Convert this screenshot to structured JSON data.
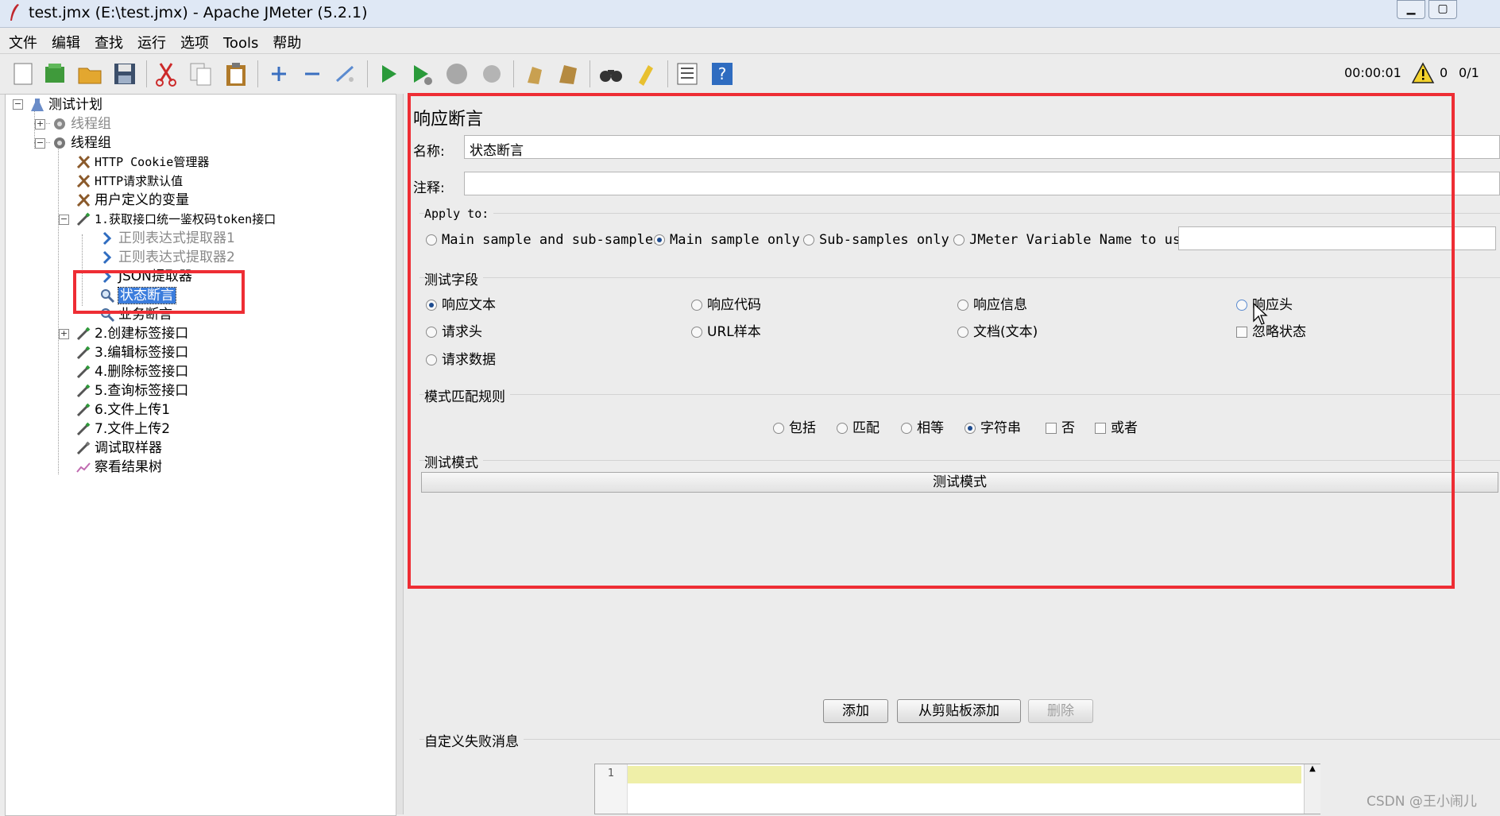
{
  "window": {
    "title": "test.jmx (E:\\test.jmx) - Apache JMeter (5.2.1)"
  },
  "menu": [
    "文件",
    "编辑",
    "查找",
    "运行",
    "选项",
    "Tools",
    "帮助"
  ],
  "status": {
    "elapsed": "00:00:01",
    "warnings": "0",
    "threads": "0/1"
  },
  "tree": {
    "root": "测试计划",
    "group1": "线程组",
    "group2": "线程组",
    "items": {
      "cookie": "HTTP Cookie管理器",
      "defaults": "HTTP请求默认值",
      "vars": "用户定义的变量",
      "req1": "1.获取接口统一鉴权码token接口",
      "regex1": "正则表达式提取器1",
      "regex2": "正则表达式提取器2",
      "json": "JSON提取器",
      "status_assert": "状态断言",
      "biz_assert": "业务断言",
      "req2": "2.创建标签接口",
      "req3": "3.编辑标签接口",
      "req4": "4.删除标签接口",
      "req5": "5.查询标签接口",
      "req6": "6.文件上传1",
      "req7": "7.文件上传2",
      "debug": "调试取样器",
      "results": "察看结果树"
    }
  },
  "panel": {
    "heading": "响应断言",
    "name_label": "名称:",
    "name_value": "状态断言",
    "comment_label": "注释:",
    "comment_value": "",
    "apply_to": {
      "label": "Apply to:",
      "options": [
        "Main sample and sub-samples",
        "Main sample only",
        "Sub-samples only",
        "JMeter Variable Name to use"
      ],
      "selected": "Main sample only"
    },
    "test_field": {
      "label": "测试字段",
      "options": [
        "响应文本",
        "响应代码",
        "响应信息",
        "响应头",
        "请求头",
        "URL样本",
        "文档(文本)",
        "请求数据"
      ],
      "ignore_status": "忽略状态",
      "selected": "响应文本"
    },
    "match_rules": {
      "label": "模式匹配规则",
      "options": [
        "包括",
        "匹配",
        "相等",
        "字符串"
      ],
      "not": "否",
      "or": "或者",
      "selected": "字符串"
    },
    "patterns": {
      "label": "测试模式",
      "column": "测试模式"
    },
    "buttons": {
      "add": "添加",
      "add_clipboard": "从剪贴板添加",
      "delete": "删除"
    },
    "failure": {
      "label": "自定义失败消息",
      "line_no": "1"
    }
  },
  "watermark": "CSDN @王小闹儿",
  "colors": {
    "highlight": "#ee2d34",
    "selection": "#3b7ddd",
    "editor_line": "#efefa8"
  }
}
